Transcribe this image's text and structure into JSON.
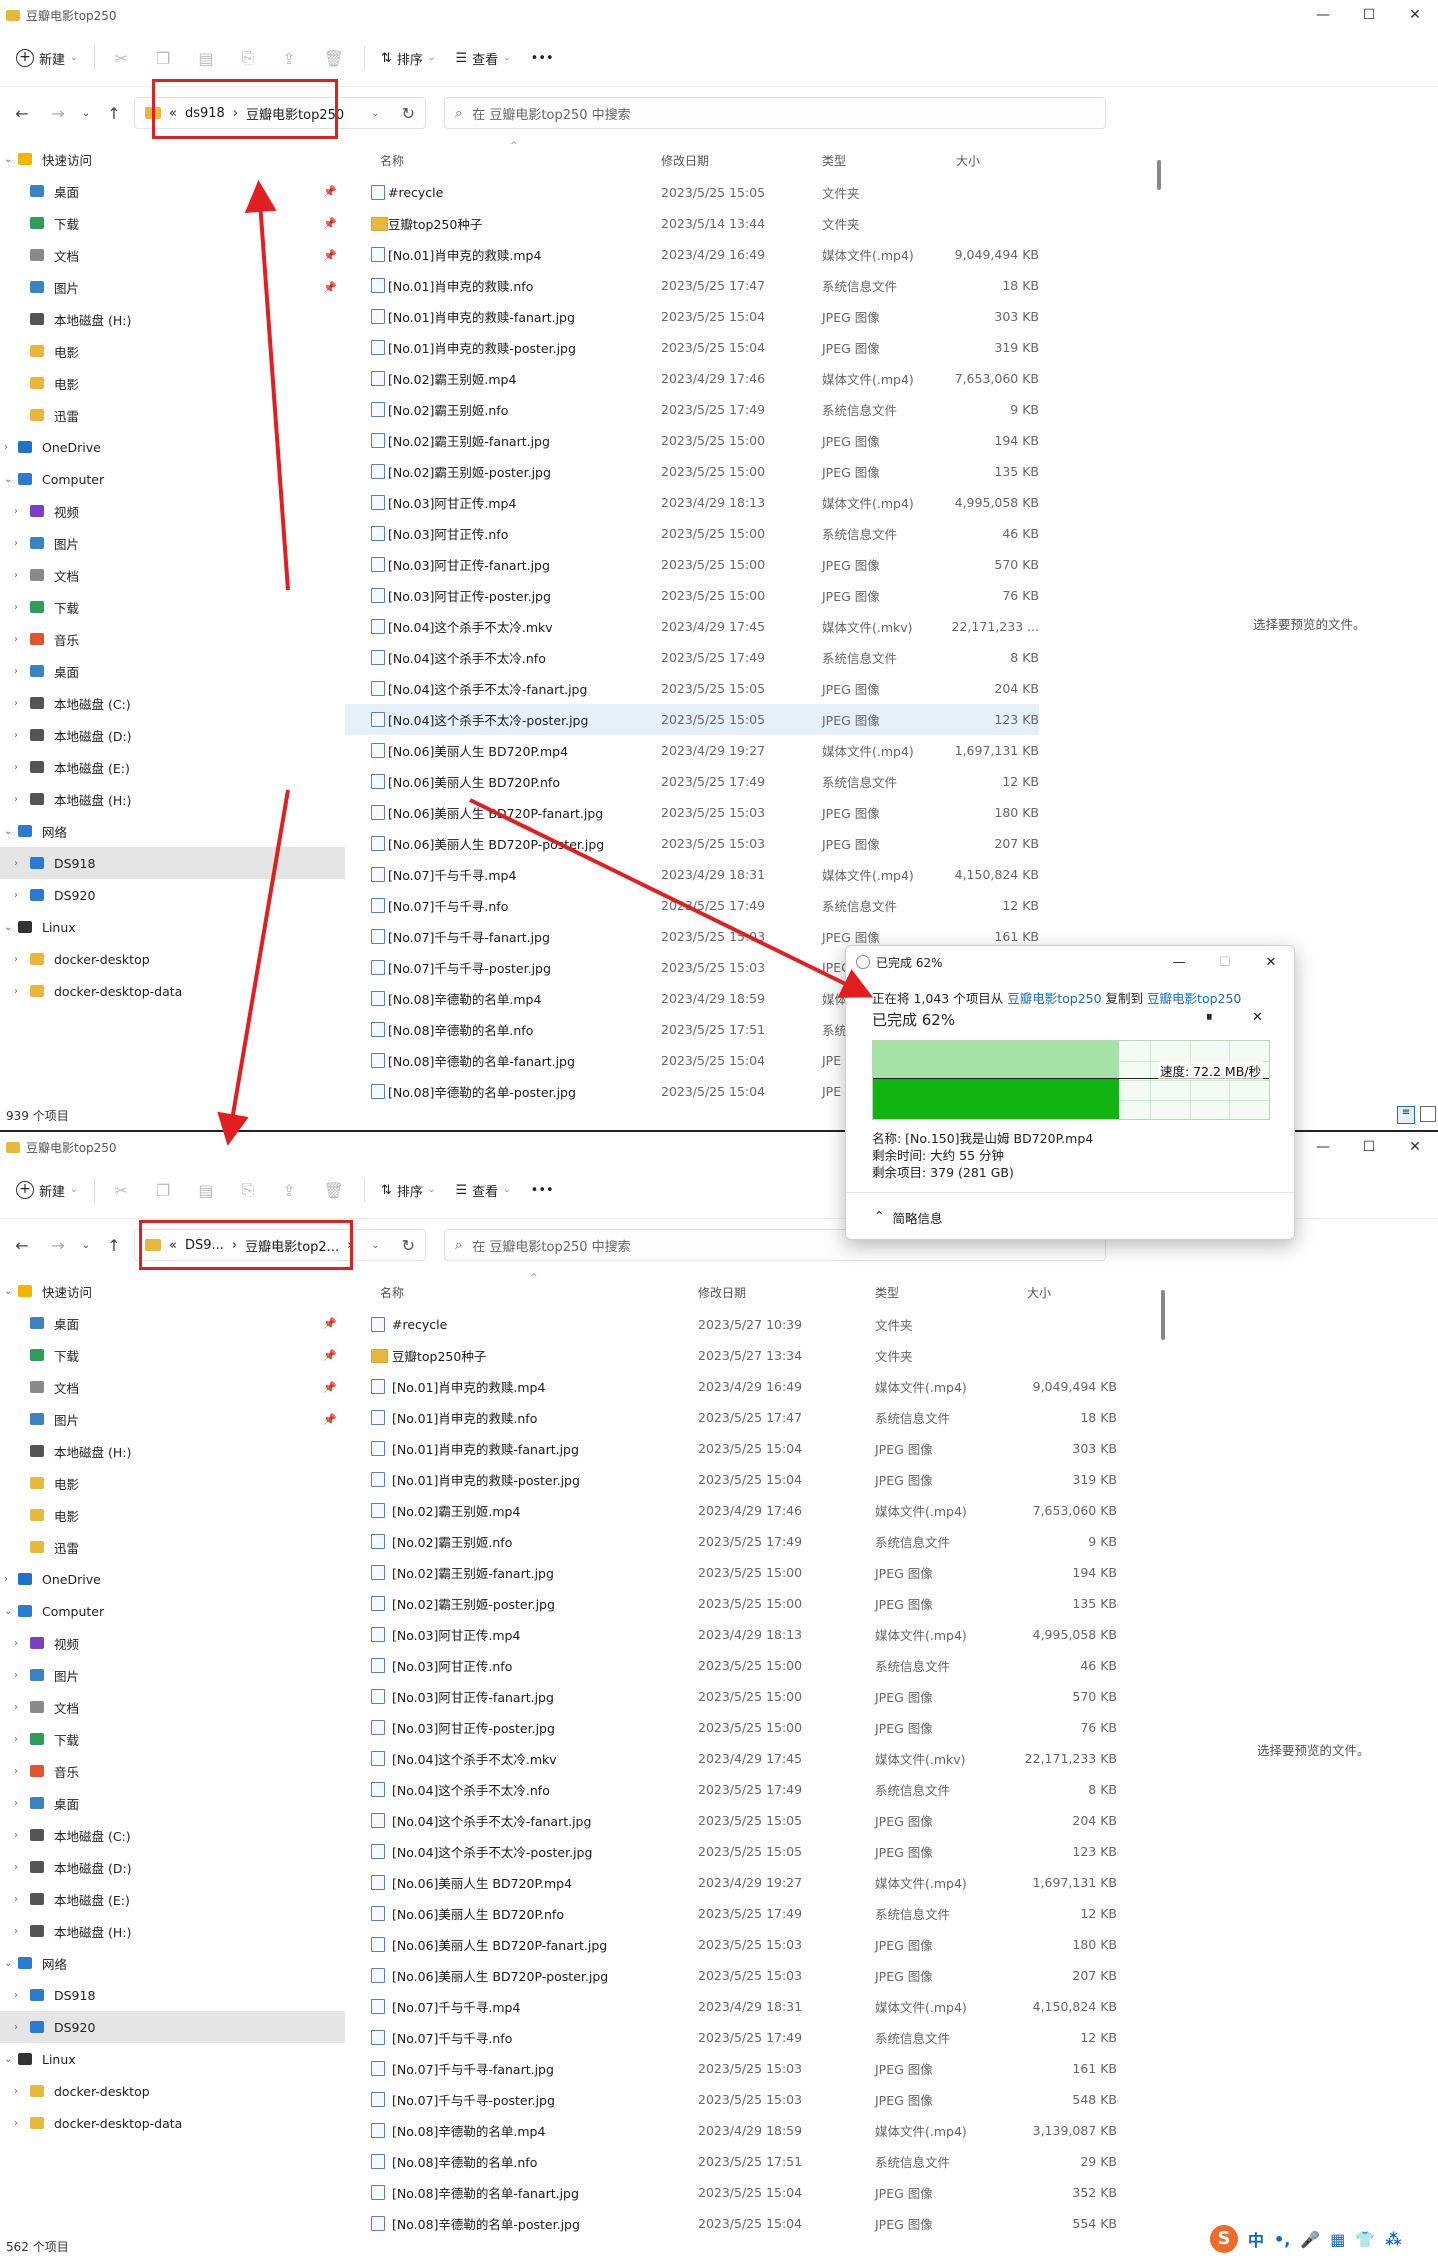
{
  "top_window": {
    "title": "豆瓣电影top250",
    "toolbar": {
      "new": "新建",
      "sort": "排序",
      "view": "查看",
      "more": "•••"
    },
    "breadcrumb": {
      "prefix": "«",
      "root": "ds918",
      "sep": "›",
      "current": "豆瓣电影top250"
    },
    "search_placeholder": "在 豆瓣电影top250 中搜索",
    "preview_text": "选择要预览的文件。",
    "status": "939 个项目",
    "selected_sidebar": "DS918"
  },
  "bottom_window": {
    "title": "豆瓣电影top250",
    "toolbar": {
      "new": "新建",
      "sort": "排序",
      "view": "查看",
      "more": "•••"
    },
    "breadcrumb": {
      "prefix": "«",
      "root": "DS9...",
      "sep": "›",
      "current": "豆瓣电影top2...",
      "tail": "›"
    },
    "search_placeholder": "在 豆瓣电影top250 中搜索",
    "preview_text": "选择要预览的文件。",
    "status": "562 个项目",
    "selected_sidebar": "DS920"
  },
  "columns": {
    "name": "名称",
    "date": "修改日期",
    "type": "类型",
    "size": "大小"
  },
  "sidebar": [
    {
      "label": "快速访问",
      "level": 0,
      "icon": "star-icon",
      "color": "#f5b400",
      "expand": "v"
    },
    {
      "label": "桌面",
      "level": 1,
      "icon": "desktop-icon",
      "color": "#3b82c4",
      "pin": true
    },
    {
      "label": "下载",
      "level": 1,
      "icon": "download-icon",
      "color": "#2e9d5a",
      "pin": true
    },
    {
      "label": "文档",
      "level": 1,
      "icon": "document-icon",
      "color": "#8a8a8a",
      "pin": true
    },
    {
      "label": "图片",
      "level": 1,
      "icon": "pictures-icon",
      "color": "#3b82c4",
      "pin": true
    },
    {
      "label": "本地磁盘 (H:)",
      "level": 1,
      "icon": "drive-icon",
      "color": "#555555"
    },
    {
      "label": "电影",
      "level": 1,
      "icon": "folder-icon",
      "color": "#e8b83e"
    },
    {
      "label": "电影",
      "level": 1,
      "icon": "folder-icon",
      "color": "#e8b83e"
    },
    {
      "label": "迅雷",
      "level": 1,
      "icon": "folder-icon",
      "color": "#e8b83e"
    },
    {
      "label": "OneDrive",
      "level": 0,
      "icon": "cloud-icon",
      "color": "#1e73c8",
      "expand": ">"
    },
    {
      "label": "Computer",
      "level": 0,
      "icon": "computer-icon",
      "color": "#2b7bd0",
      "expand": "v"
    },
    {
      "label": "视频",
      "level": 1,
      "icon": "video-icon",
      "color": "#7b3fc6",
      "expand": ">"
    },
    {
      "label": "图片",
      "level": 1,
      "icon": "pictures-icon",
      "color": "#3b82c4",
      "expand": ">"
    },
    {
      "label": "文档",
      "level": 1,
      "icon": "document-icon",
      "color": "#8a8a8a",
      "expand": ">"
    },
    {
      "label": "下载",
      "level": 1,
      "icon": "download-icon",
      "color": "#2e9d5a",
      "expand": ">"
    },
    {
      "label": "音乐",
      "level": 1,
      "icon": "music-icon",
      "color": "#e0542e",
      "expand": ">"
    },
    {
      "label": "桌面",
      "level": 1,
      "icon": "desktop-icon",
      "color": "#3b82c4",
      "expand": ">"
    },
    {
      "label": "本地磁盘 (C:)",
      "level": 1,
      "icon": "drive-icon",
      "color": "#555555",
      "expand": ">"
    },
    {
      "label": "本地磁盘 (D:)",
      "level": 1,
      "icon": "drive-icon",
      "color": "#555555",
      "expand": ">"
    },
    {
      "label": "本地磁盘 (E:)",
      "level": 1,
      "icon": "drive-icon",
      "color": "#555555",
      "expand": ">"
    },
    {
      "label": "本地磁盘 (H:)",
      "level": 1,
      "icon": "drive-icon",
      "color": "#555555",
      "expand": ">"
    },
    {
      "label": "网络",
      "level": 0,
      "icon": "network-icon",
      "color": "#2b7bd0",
      "expand": "v"
    },
    {
      "label": "DS918",
      "level": 1,
      "icon": "nas-icon",
      "color": "#2b7bd0",
      "expand": ">"
    },
    {
      "label": "DS920",
      "level": 1,
      "icon": "nas-icon",
      "color": "#2b7bd0",
      "expand": ">"
    },
    {
      "label": "Linux",
      "level": 0,
      "icon": "linux-icon",
      "color": "#333333",
      "expand": "v"
    },
    {
      "label": "docker-desktop",
      "level": 1,
      "icon": "folder-icon",
      "color": "#e8b83e",
      "expand": ">"
    },
    {
      "label": "docker-desktop-data",
      "level": 1,
      "icon": "folder-icon",
      "color": "#e8b83e",
      "expand": ">"
    }
  ],
  "files_top": [
    {
      "name": "#recycle",
      "date": "2023/5/25 15:05",
      "type": "文件夹",
      "size": "",
      "kind": "special"
    },
    {
      "name": "豆瓣top250种子",
      "date": "2023/5/14 13:44",
      "type": "文件夹",
      "size": "",
      "kind": "folder"
    },
    {
      "name": "[No.01]肖申克的救赎.mp4",
      "date": "2023/4/29 16:49",
      "type": "媒体文件(.mp4)",
      "size": "9,049,494 KB",
      "kind": "file"
    },
    {
      "name": "[No.01]肖申克的救赎.nfo",
      "date": "2023/5/25 17:47",
      "type": "系统信息文件",
      "size": "18 KB",
      "kind": "file"
    },
    {
      "name": "[No.01]肖申克的救赎-fanart.jpg",
      "date": "2023/5/25 15:04",
      "type": "JPEG 图像",
      "size": "303 KB",
      "kind": "file"
    },
    {
      "name": "[No.01]肖申克的救赎-poster.jpg",
      "date": "2023/5/25 15:04",
      "type": "JPEG 图像",
      "size": "319 KB",
      "kind": "file"
    },
    {
      "name": "[No.02]霸王别姬.mp4",
      "date": "2023/4/29 17:46",
      "type": "媒体文件(.mp4)",
      "size": "7,653,060 KB",
      "kind": "file"
    },
    {
      "name": "[No.02]霸王别姬.nfo",
      "date": "2023/5/25 17:49",
      "type": "系统信息文件",
      "size": "9 KB",
      "kind": "file"
    },
    {
      "name": "[No.02]霸王别姬-fanart.jpg",
      "date": "2023/5/25 15:00",
      "type": "JPEG 图像",
      "size": "194 KB",
      "kind": "file"
    },
    {
      "name": "[No.02]霸王别姬-poster.jpg",
      "date": "2023/5/25 15:00",
      "type": "JPEG 图像",
      "size": "135 KB",
      "kind": "file"
    },
    {
      "name": "[No.03]阿甘正传.mp4",
      "date": "2023/4/29 18:13",
      "type": "媒体文件(.mp4)",
      "size": "4,995,058 KB",
      "kind": "file"
    },
    {
      "name": "[No.03]阿甘正传.nfo",
      "date": "2023/5/25 15:00",
      "type": "系统信息文件",
      "size": "46 KB",
      "kind": "file"
    },
    {
      "name": "[No.03]阿甘正传-fanart.jpg",
      "date": "2023/5/25 15:00",
      "type": "JPEG 图像",
      "size": "570 KB",
      "kind": "file"
    },
    {
      "name": "[No.03]阿甘正传-poster.jpg",
      "date": "2023/5/25 15:00",
      "type": "JPEG 图像",
      "size": "76 KB",
      "kind": "file"
    },
    {
      "name": "[No.04]这个杀手不太冷.mkv",
      "date": "2023/4/29 17:45",
      "type": "媒体文件(.mkv)",
      "size": "22,171,233 ...",
      "kind": "file"
    },
    {
      "name": "[No.04]这个杀手不太冷.nfo",
      "date": "2023/5/25 17:49",
      "type": "系统信息文件",
      "size": "8 KB",
      "kind": "file"
    },
    {
      "name": "[No.04]这个杀手不太冷-fanart.jpg",
      "date": "2023/5/25 15:05",
      "type": "JPEG 图像",
      "size": "204 KB",
      "kind": "file"
    },
    {
      "name": "[No.04]这个杀手不太冷-poster.jpg",
      "date": "2023/5/25 15:05",
      "type": "JPEG 图像",
      "size": "123 KB",
      "kind": "file",
      "selected": true
    },
    {
      "name": "[No.06]美丽人生 BD720P.mp4",
      "date": "2023/4/29 19:27",
      "type": "媒体文件(.mp4)",
      "size": "1,697,131 KB",
      "kind": "file"
    },
    {
      "name": "[No.06]美丽人生 BD720P.nfo",
      "date": "2023/5/25 17:49",
      "type": "系统信息文件",
      "size": "12 KB",
      "kind": "file"
    },
    {
      "name": "[No.06]美丽人生 BD720P-fanart.jpg",
      "date": "2023/5/25 15:03",
      "type": "JPEG 图像",
      "size": "180 KB",
      "kind": "file"
    },
    {
      "name": "[No.06]美丽人生 BD720P-poster.jpg",
      "date": "2023/5/25 15:03",
      "type": "JPEG 图像",
      "size": "207 KB",
      "kind": "file"
    },
    {
      "name": "[No.07]千与千寻.mp4",
      "date": "2023/4/29 18:31",
      "type": "媒体文件(.mp4)",
      "size": "4,150,824 KB",
      "kind": "file"
    },
    {
      "name": "[No.07]千与千寻.nfo",
      "date": "2023/5/25 17:49",
      "type": "系统信息文件",
      "size": "12 KB",
      "kind": "file"
    },
    {
      "name": "[No.07]千与千寻-fanart.jpg",
      "date": "2023/5/25 15:03",
      "type": "JPEG 图像",
      "size": "161 KB",
      "kind": "file"
    },
    {
      "name": "[No.07]千与千寻-poster.jpg",
      "date": "2023/5/25 15:03",
      "type": "JPEG",
      "size": "",
      "kind": "file"
    },
    {
      "name": "[No.08]辛德勒的名单.mp4",
      "date": "2023/4/29 18:59",
      "type": "媒体",
      "size": "",
      "kind": "file"
    },
    {
      "name": "[No.08]辛德勒的名单.nfo",
      "date": "2023/5/25 17:51",
      "type": "系统",
      "size": "",
      "kind": "file"
    },
    {
      "name": "[No.08]辛德勒的名单-fanart.jpg",
      "date": "2023/5/25 15:04",
      "type": "JPE",
      "size": "",
      "kind": "file"
    },
    {
      "name": "[No.08]辛德勒的名单-poster.jpg",
      "date": "2023/5/25 15:04",
      "type": "JPE",
      "size": "",
      "kind": "file"
    }
  ],
  "files_bottom": [
    {
      "name": "#recycle",
      "date": "2023/5/27 10:39",
      "type": "文件夹",
      "size": "",
      "kind": "special"
    },
    {
      "name": "豆瓣top250种子",
      "date": "2023/5/27 13:34",
      "type": "文件夹",
      "size": "",
      "kind": "folder"
    },
    {
      "name": "[No.01]肖申克的救赎.mp4",
      "date": "2023/4/29 16:49",
      "type": "媒体文件(.mp4)",
      "size": "9,049,494 KB",
      "kind": "file"
    },
    {
      "name": "[No.01]肖申克的救赎.nfo",
      "date": "2023/5/25 17:47",
      "type": "系统信息文件",
      "size": "18 KB",
      "kind": "file"
    },
    {
      "name": "[No.01]肖申克的救赎-fanart.jpg",
      "date": "2023/5/25 15:04",
      "type": "JPEG 图像",
      "size": "303 KB",
      "kind": "file"
    },
    {
      "name": "[No.01]肖申克的救赎-poster.jpg",
      "date": "2023/5/25 15:04",
      "type": "JPEG 图像",
      "size": "319 KB",
      "kind": "file"
    },
    {
      "name": "[No.02]霸王别姬.mp4",
      "date": "2023/4/29 17:46",
      "type": "媒体文件(.mp4)",
      "size": "7,653,060 KB",
      "kind": "file"
    },
    {
      "name": "[No.02]霸王别姬.nfo",
      "date": "2023/5/25 17:49",
      "type": "系统信息文件",
      "size": "9 KB",
      "kind": "file"
    },
    {
      "name": "[No.02]霸王别姬-fanart.jpg",
      "date": "2023/5/25 15:00",
      "type": "JPEG 图像",
      "size": "194 KB",
      "kind": "file"
    },
    {
      "name": "[No.02]霸王别姬-poster.jpg",
      "date": "2023/5/25 15:00",
      "type": "JPEG 图像",
      "size": "135 KB",
      "kind": "file"
    },
    {
      "name": "[No.03]阿甘正传.mp4",
      "date": "2023/4/29 18:13",
      "type": "媒体文件(.mp4)",
      "size": "4,995,058 KB",
      "kind": "file"
    },
    {
      "name": "[No.03]阿甘正传.nfo",
      "date": "2023/5/25 15:00",
      "type": "系统信息文件",
      "size": "46 KB",
      "kind": "file"
    },
    {
      "name": "[No.03]阿甘正传-fanart.jpg",
      "date": "2023/5/25 15:00",
      "type": "JPEG 图像",
      "size": "570 KB",
      "kind": "file"
    },
    {
      "name": "[No.03]阿甘正传-poster.jpg",
      "date": "2023/5/25 15:00",
      "type": "JPEG 图像",
      "size": "76 KB",
      "kind": "file"
    },
    {
      "name": "[No.04]这个杀手不太冷.mkv",
      "date": "2023/4/29 17:45",
      "type": "媒体文件(.mkv)",
      "size": "22,171,233 KB",
      "kind": "file"
    },
    {
      "name": "[No.04]这个杀手不太冷.nfo",
      "date": "2023/5/25 17:49",
      "type": "系统信息文件",
      "size": "8 KB",
      "kind": "file"
    },
    {
      "name": "[No.04]这个杀手不太冷-fanart.jpg",
      "date": "2023/5/25 15:05",
      "type": "JPEG 图像",
      "size": "204 KB",
      "kind": "file"
    },
    {
      "name": "[No.04]这个杀手不太冷-poster.jpg",
      "date": "2023/5/25 15:05",
      "type": "JPEG 图像",
      "size": "123 KB",
      "kind": "file"
    },
    {
      "name": "[No.06]美丽人生 BD720P.mp4",
      "date": "2023/4/29 19:27",
      "type": "媒体文件(.mp4)",
      "size": "1,697,131 KB",
      "kind": "file"
    },
    {
      "name": "[No.06]美丽人生 BD720P.nfo",
      "date": "2023/5/25 17:49",
      "type": "系统信息文件",
      "size": "12 KB",
      "kind": "file"
    },
    {
      "name": "[No.06]美丽人生 BD720P-fanart.jpg",
      "date": "2023/5/25 15:03",
      "type": "JPEG 图像",
      "size": "180 KB",
      "kind": "file"
    },
    {
      "name": "[No.06]美丽人生 BD720P-poster.jpg",
      "date": "2023/5/25 15:03",
      "type": "JPEG 图像",
      "size": "207 KB",
      "kind": "file"
    },
    {
      "name": "[No.07]千与千寻.mp4",
      "date": "2023/4/29 18:31",
      "type": "媒体文件(.mp4)",
      "size": "4,150,824 KB",
      "kind": "file"
    },
    {
      "name": "[No.07]千与千寻.nfo",
      "date": "2023/5/25 17:49",
      "type": "系统信息文件",
      "size": "12 KB",
      "kind": "file"
    },
    {
      "name": "[No.07]千与千寻-fanart.jpg",
      "date": "2023/5/25 15:03",
      "type": "JPEG 图像",
      "size": "161 KB",
      "kind": "file"
    },
    {
      "name": "[No.07]千与千寻-poster.jpg",
      "date": "2023/5/25 15:03",
      "type": "JPEG 图像",
      "size": "548 KB",
      "kind": "file"
    },
    {
      "name": "[No.08]辛德勒的名单.mp4",
      "date": "2023/4/29 18:59",
      "type": "媒体文件(.mp4)",
      "size": "3,139,087 KB",
      "kind": "file"
    },
    {
      "name": "[No.08]辛德勒的名单.nfo",
      "date": "2023/5/25 17:51",
      "type": "系统信息文件",
      "size": "29 KB",
      "kind": "file"
    },
    {
      "name": "[No.08]辛德勒的名单-fanart.jpg",
      "date": "2023/5/25 15:04",
      "type": "JPEG 图像",
      "size": "352 KB",
      "kind": "file"
    },
    {
      "name": "[No.08]辛德勒的名单-poster.jpg",
      "date": "2023/5/25 15:04",
      "type": "JPEG 图像",
      "size": "554 KB",
      "kind": "file"
    }
  ],
  "copy_dialog": {
    "title": "已完成 62%",
    "line1_prefix": "正在将 1,043 个项目从",
    "source": "豆瓣电影top250",
    "line1_mid": "复制到",
    "dest": "豆瓣电影top250",
    "progress_label": "已完成 62%",
    "progress": 0.62,
    "speed": "速度: 72.2 MB/秒",
    "name_line": "名称: [No.150]我是山姆 BD720P.mp4",
    "time_line": "剩余时间: 大约 55 分钟",
    "items_line": "剩余项目: 379 (281 GB)",
    "less_info": "简略信息",
    "pause": "⏸",
    "stop": "✕",
    "graph_color_light": "#a6e3a6",
    "graph_color_dark": "#11b511"
  },
  "taskbar": {
    "ime": "S",
    "lang": "中",
    "punct": "•,",
    "mic": "🎤",
    "keyboard": "▦",
    "shirt": "👕",
    "apps": "⁂"
  },
  "colors": {
    "accent_red": "#e02020",
    "selected_row": "#e6f0fa",
    "folder": "#e8b83e"
  }
}
